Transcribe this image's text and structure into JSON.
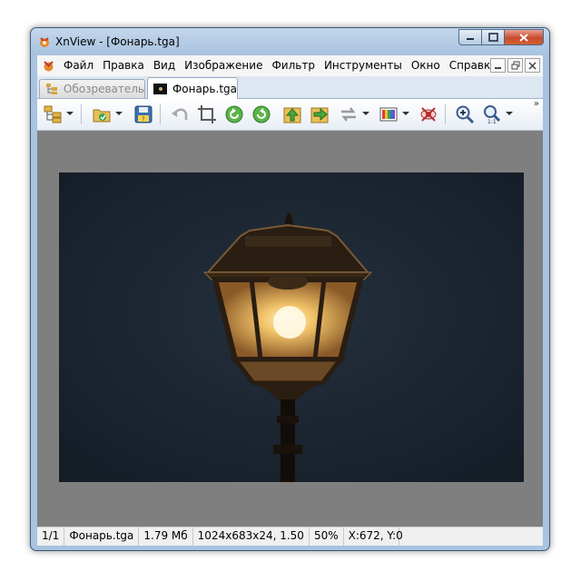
{
  "window": {
    "title": "XnView - [Фонарь.tga]"
  },
  "menu": [
    "Файл",
    "Правка",
    "Вид",
    "Изображение",
    "Фильтр",
    "Инструменты",
    "Окно",
    "Справка"
  ],
  "tabs": [
    {
      "label": "Обозреватель",
      "active": false
    },
    {
      "label": "Фонарь.tga",
      "active": true
    }
  ],
  "toolbar": {
    "icons": [
      "browser-icon",
      "open-folder-icon",
      "save-icon",
      "undo-icon",
      "crop-icon",
      "rotate-left-icon",
      "rotate-right-icon",
      "previous-icon",
      "next-icon",
      "transform-icon",
      "adjust-colors-icon",
      "red-eye-icon",
      "zoom-in-icon",
      "zoom-fit-icon"
    ],
    "more_glyph": "»"
  },
  "statusbar": {
    "index": "1/1",
    "filename": "Фонарь.tga",
    "filesize": "1.79 Мб",
    "dimensions": "1024x683x24, 1.50",
    "zoom": "50%",
    "coords": "X:672, Y:0"
  },
  "colors": {
    "viewer_background": "#7f7f7f",
    "titlebar": "#b4cce6",
    "close_button": "#c94a2f"
  }
}
